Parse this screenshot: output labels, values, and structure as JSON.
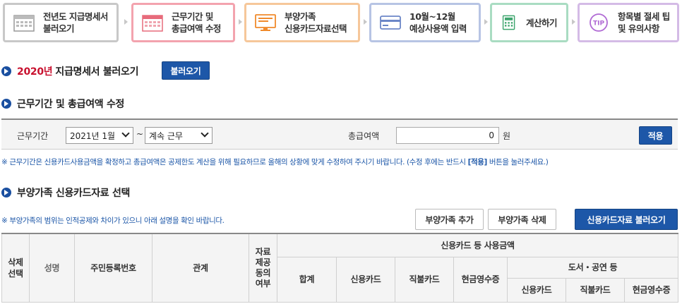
{
  "steps": [
    {
      "icon": "calendar-grid-icon",
      "line1": "전년도 지급명세서",
      "line2": "불러오기"
    },
    {
      "icon": "calendar-icon",
      "line1": "근무기간 및",
      "line2": "총급여액 수정"
    },
    {
      "icon": "monitor-icon",
      "line1": "부양가족",
      "line2": "신용카드자료선택"
    },
    {
      "icon": "credit-card-icon",
      "line1": "10월~12월",
      "line2": "예상사용액 입력"
    },
    {
      "icon": "calculator-icon",
      "line1": "계산하기",
      "line2": ""
    },
    {
      "icon": "tip-icon",
      "line1": "항목별 절세 팁",
      "line2": "및 유의사항"
    }
  ],
  "step_colors": [
    "#c8c8c8",
    "#f3a3ae",
    "#f6c79a",
    "#b7c4e4",
    "#a9dcc2",
    "#d4bbe6"
  ],
  "tip_icon_text": "TIP",
  "section1": {
    "year": "2020년",
    "title": "지급명세서 불러오기",
    "button": "불러오기"
  },
  "section2": {
    "title": "근무기간 및 총급여액 수정"
  },
  "period": {
    "label": "근무기간",
    "start_value": "2021년 1월",
    "tilde": "~",
    "end_value": "계속 근무",
    "salary_label": "총급여액",
    "salary_value": "0",
    "salary_unit": "원",
    "apply_button": "적용"
  },
  "note2": {
    "before": "※ 근무기간은 신용카드사용금액을 확정하고 총급여액은 공제한도 계산을 위해 필요하므로 올해의 상황에 맞게 수정하여 주시기 바랍니다. (수정 후에는 반드시 ",
    "bold": "[적용]",
    "after": " 버튼을 눌러주세요.)"
  },
  "section3": {
    "title": "부양가족 신용카드자료 선택"
  },
  "note3": "※ 부양가족의 범위는 인적공제와 차이가 있으니 아래 설명을 확인 바랍니다.",
  "buttons3": {
    "add": "부양가족 추가",
    "delete": "부양가족 삭제",
    "load_card": "신용카드자료 불러오기"
  },
  "table": {
    "col_delete": "삭제\n선택",
    "col_name": "성명",
    "col_rrn": "주민등록번호",
    "col_relation": "관계",
    "col_provided": "자료\n제공\n동의\n여부",
    "group_card": "신용카드 등 사용금액",
    "col_total": "합계",
    "col_credit": "신용카드",
    "col_debit": "직불카드",
    "col_cash": "현금영수증",
    "group_books": "도서・공연 등",
    "sub_credit": "신용카드",
    "sub_debit": "직불카드",
    "sub_cash": "현금영수증"
  }
}
